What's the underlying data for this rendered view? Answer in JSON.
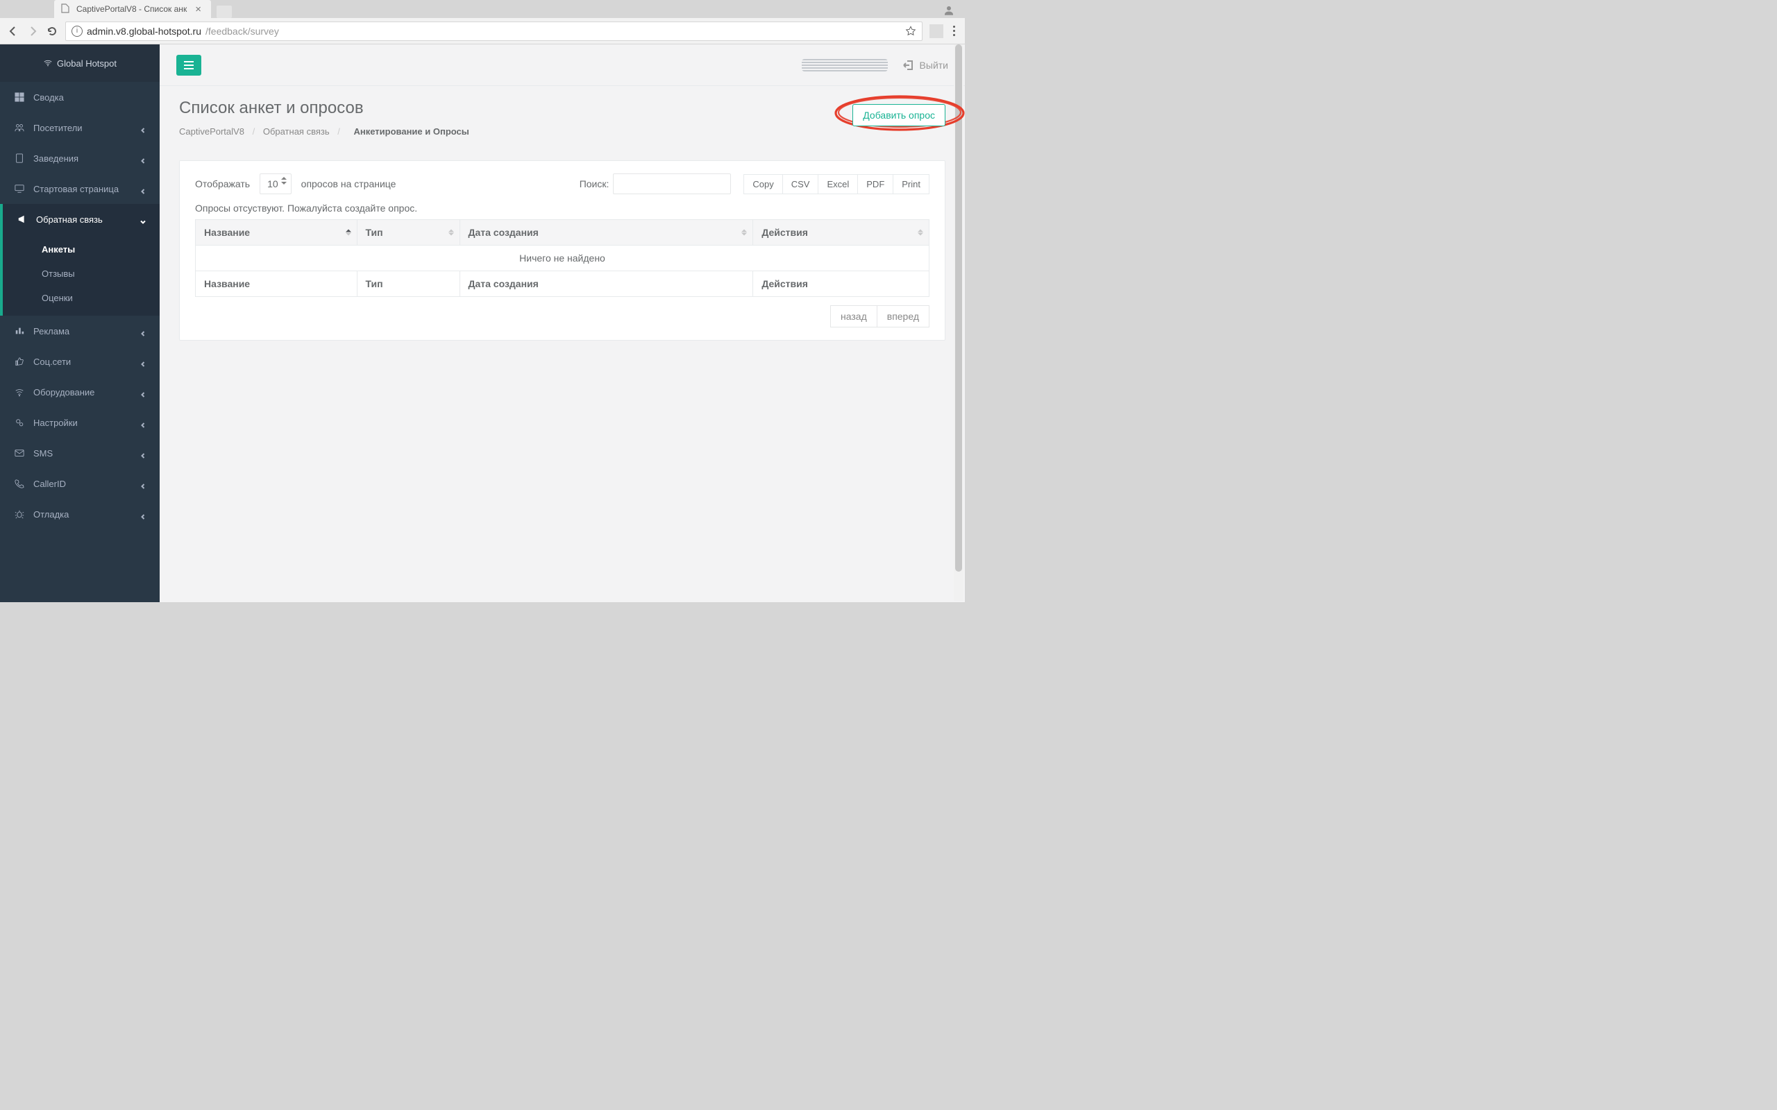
{
  "browser": {
    "tab_title": "CaptivePortalV8 - Список анк",
    "url_host": "admin.v8.global-hotspot.ru",
    "url_path": "/feedback/survey"
  },
  "brand": "Global Hotspot",
  "topbar": {
    "logout": "Выйти"
  },
  "sidebar": {
    "items": [
      {
        "label": "Сводка",
        "expandable": false
      },
      {
        "label": "Посетители",
        "expandable": true
      },
      {
        "label": "Заведения",
        "expandable": true
      },
      {
        "label": "Стартовая страница",
        "expandable": true
      },
      {
        "label": "Обратная связь",
        "expandable": true,
        "active": true
      },
      {
        "label": "Реклама",
        "expandable": true
      },
      {
        "label": "Соц.сети",
        "expandable": true
      },
      {
        "label": "Оборудование",
        "expandable": true
      },
      {
        "label": "Настройки",
        "expandable": true
      },
      {
        "label": "SMS",
        "expandable": true
      },
      {
        "label": "CallerID",
        "expandable": true
      },
      {
        "label": "Отладка",
        "expandable": true
      }
    ],
    "feedback_sub": [
      {
        "label": "Анкеты",
        "selected": true
      },
      {
        "label": "Отзывы"
      },
      {
        "label": "Оценки"
      }
    ]
  },
  "page": {
    "title": "Список анкет и опросов",
    "breadcrumb": {
      "a": "CaptivePortalV8",
      "b": "Обратная связь",
      "c": "Анкетирование и Опросы"
    },
    "add_button": "Добавить опрос"
  },
  "table": {
    "length_prefix": "Отображать",
    "length_value": "10",
    "length_suffix": "опросов на странице",
    "search_label": "Поиск:",
    "buttons": {
      "copy": "Copy",
      "csv": "CSV",
      "excel": "Excel",
      "pdf": "PDF",
      "print": "Print"
    },
    "no_data_note": "Опросы отсуствуют. Пожалуйста создайте опрос.",
    "columns": {
      "name": "Название",
      "type": "Тип",
      "created": "Дата создания",
      "actions": "Действия"
    },
    "empty_row": "Ничего не найдено",
    "pager": {
      "prev": "назад",
      "next": "вперед"
    }
  },
  "colors": {
    "accent": "#1ab394",
    "sidebar": "#293846",
    "highlight": "#e63e2c"
  }
}
